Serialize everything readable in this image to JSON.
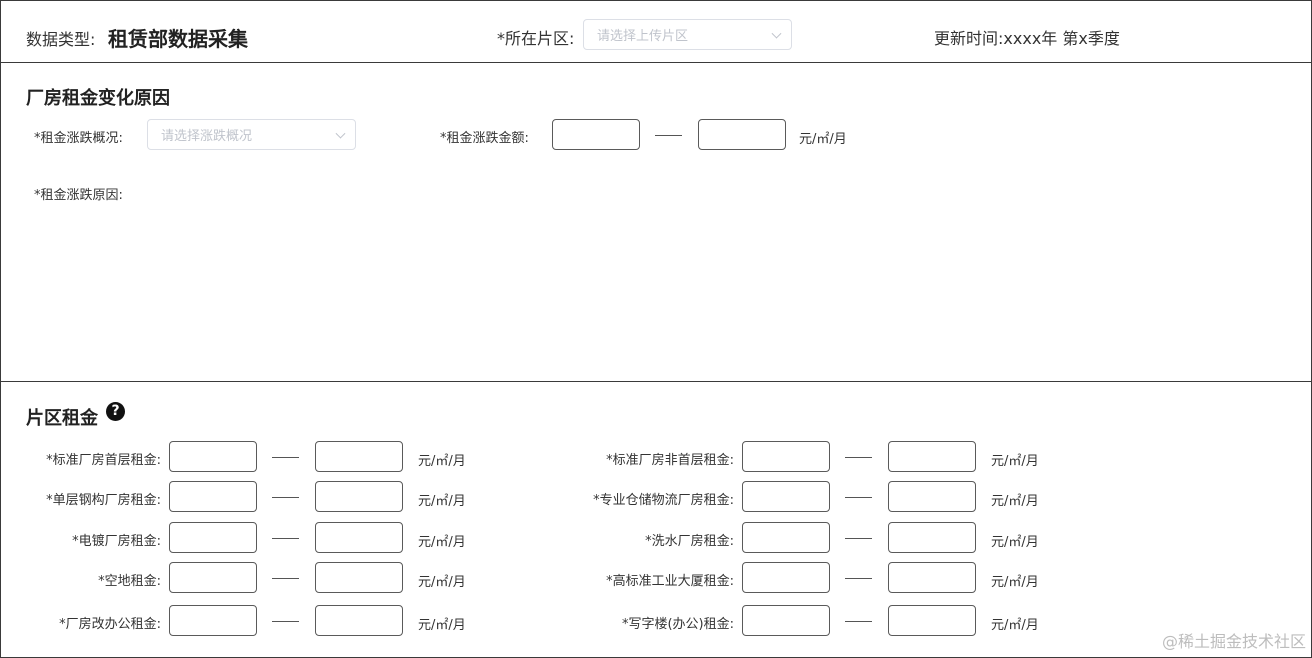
{
  "header": {
    "data_type_label": "数据类型:",
    "data_type_value": "租赁部数据采集",
    "area_label": "*所在片区:",
    "area_placeholder": "请选择上传片区",
    "update_label": "更新时间:",
    "update_value": "xxxx年 第x季度"
  },
  "change_section": {
    "title": "厂房租金变化原因",
    "trend_label": "*租金涨跌概况:",
    "trend_placeholder": "请选择涨跌概况",
    "amount_label": "*租金涨跌金额:",
    "amount_unit": "元/㎡/月",
    "reason_label": "*租金涨跌原因:"
  },
  "rent_section": {
    "title": "片区租金",
    "help_icon": "question-circle-icon",
    "unit": "元/㎡/月",
    "left_rows": [
      {
        "label": "*标准厂房首层租金:"
      },
      {
        "label": "*单层钢构厂房租金:"
      },
      {
        "label": "*电镀厂房租金:"
      },
      {
        "label": "*空地租金:"
      },
      {
        "label": "*厂房改办公租金:"
      }
    ],
    "right_rows": [
      {
        "label": "*标准厂房非首层租金:"
      },
      {
        "label": "*专业仓储物流厂房租金:"
      },
      {
        "label": "*洗水厂房租金:"
      },
      {
        "label": "*高标准工业大厦租金:"
      },
      {
        "label": "*写字楼(办公)租金:"
      }
    ]
  },
  "watermark": "@稀土掘金技术社区"
}
